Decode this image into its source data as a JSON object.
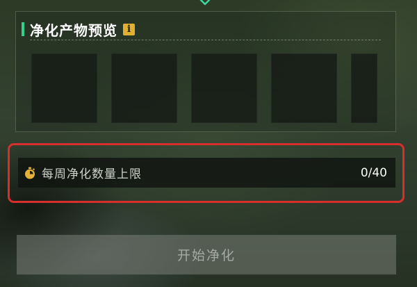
{
  "preview": {
    "title": "净化产物预览",
    "info_icon": "i",
    "slot_count": 5
  },
  "weekly_limit": {
    "label": "每周净化数量上限",
    "value": "0/40"
  },
  "start_button": {
    "label": "开始净化"
  },
  "colors": {
    "title_accent": "#2fd28c",
    "info_icon_bg": "#e0b030",
    "timer_icon": "#e2b13a",
    "highlight_frame": "#d92e2e",
    "chevron": "#3fd6a0"
  }
}
